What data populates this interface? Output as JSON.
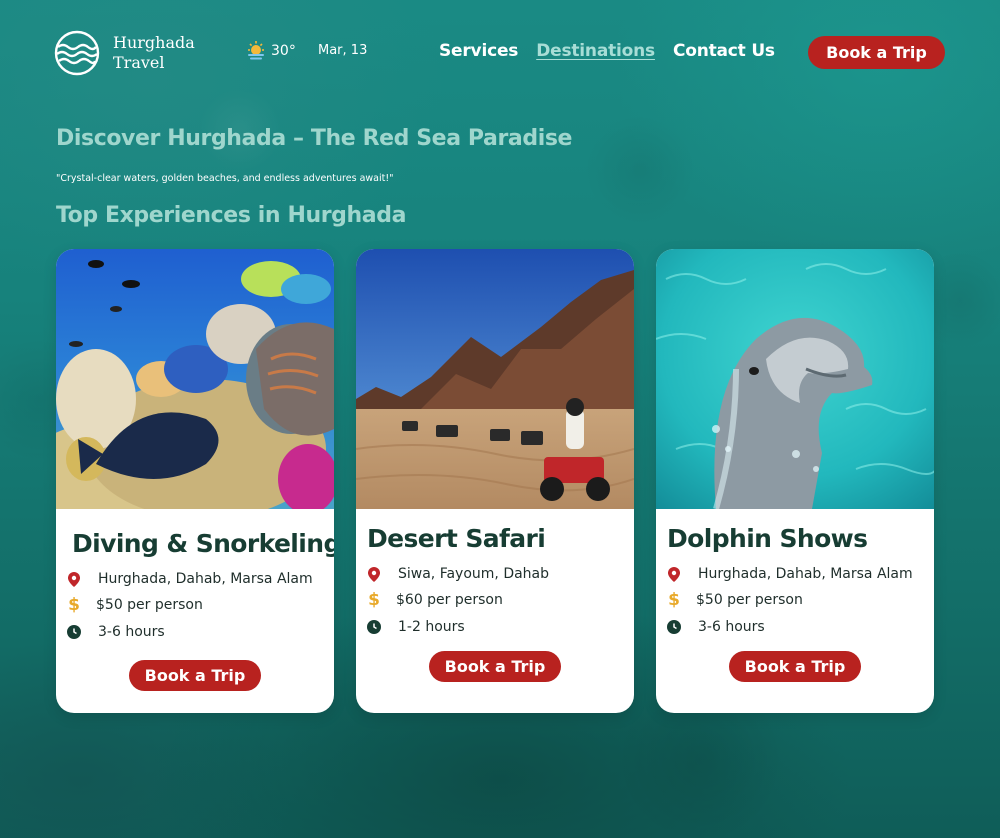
{
  "brand": {
    "line1": "Hurghada",
    "line2": "Travel"
  },
  "weather": {
    "temp": "30°",
    "icon": "sun-cloud-icon"
  },
  "date": "Mar, 13",
  "nav": [
    {
      "label": "Services",
      "active": false
    },
    {
      "label": "Destinations",
      "active": true
    },
    {
      "label": "Contact Us",
      "active": false
    }
  ],
  "header_cta": "Book a Trip",
  "hero": {
    "title": "Discover Hurghada – The Red Sea Paradise",
    "subtitle": "\"Crystal-clear waters, golden beaches, and endless adventures await!\""
  },
  "section_title": "Top Experiences in Hurghada",
  "cards": [
    {
      "title": "Diving & Snorkeling",
      "locations": "Hurghada, Dahab, Marsa Alam",
      "price": "$50 per person",
      "duration": "3-6 hours",
      "cta": "Book a Trip"
    },
    {
      "title": "Desert Safari",
      "locations": "Siwa, Fayoum, Dahab",
      "price": "$60 per person",
      "duration": "1-2 hours",
      "cta": "Book a Trip"
    },
    {
      "title": "Dolphin Shows",
      "locations": "Hurghada, Dahab, Marsa Alam",
      "price": "$50 per person",
      "duration": "3-6 hours",
      "cta": "Book a Trip"
    }
  ],
  "colors": {
    "accent": "#b8221f",
    "heading": "#9fd6cd",
    "card_title": "#173d33",
    "price_icon": "#e8a92a"
  }
}
